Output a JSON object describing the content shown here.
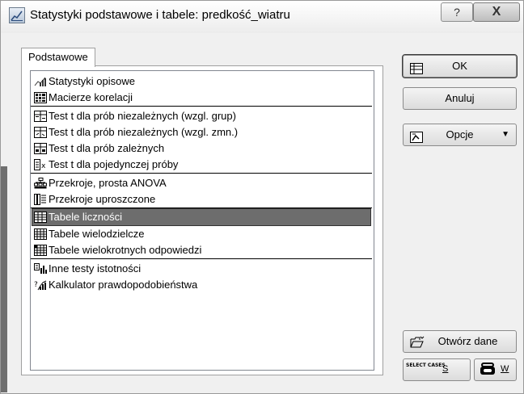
{
  "window": {
    "title": "Statystyki podstawowe i tabele: predkość_wiatru",
    "help_label": "?",
    "close_label": "X"
  },
  "tabs": [
    {
      "label": "Podstawowe",
      "active": true
    }
  ],
  "list": {
    "items": [
      {
        "label": "Statystyki opisowe",
        "icon": "descriptive-stats-icon",
        "selected": false
      },
      {
        "label": "Macierze korelacji",
        "icon": "correlation-matrix-icon",
        "selected": false
      },
      {
        "label": "Test t dla prób niezależnych (wzgl. grup)",
        "icon": "ttest-groups-icon",
        "selected": false
      },
      {
        "label": "Test t dla prób niezależnych (wzgl. zmn.)",
        "icon": "ttest-variables-icon",
        "selected": false
      },
      {
        "label": "Test t dla prób zależnych",
        "icon": "ttest-dependent-icon",
        "selected": false
      },
      {
        "label": "Test t dla pojedynczej próby",
        "icon": "ttest-single-icon",
        "selected": false
      },
      {
        "label": "Przekroje, prosta ANOVA",
        "icon": "anova-icon",
        "selected": false
      },
      {
        "label": "Przekroje uproszczone",
        "icon": "simple-breakdown-icon",
        "selected": false
      },
      {
        "label": "Tabele liczności",
        "icon": "frequency-table-icon",
        "selected": true
      },
      {
        "label": "Tabele wielodzielcze",
        "icon": "crosstab-icon",
        "selected": false
      },
      {
        "label": "Tabele wielokrotnych odpowiedzi",
        "icon": "multiple-response-icon",
        "selected": false
      },
      {
        "label": "Inne testy istotności",
        "icon": "significance-tests-icon",
        "selected": false
      },
      {
        "label": "Kalkulator prawdopodobieństwa",
        "icon": "probability-calculator-icon",
        "selected": false
      }
    ]
  },
  "buttons": {
    "ok": "OK",
    "cancel": "Anuluj",
    "options": "Opcje",
    "open_data": "Otwórz dane",
    "select_cases_tag": "SELECT CASES",
    "select_cases_key": "S",
    "weight_key": "W"
  },
  "colors": {
    "selected_bg": "#6d6d6d",
    "window_bg": "#f0f0f0"
  }
}
